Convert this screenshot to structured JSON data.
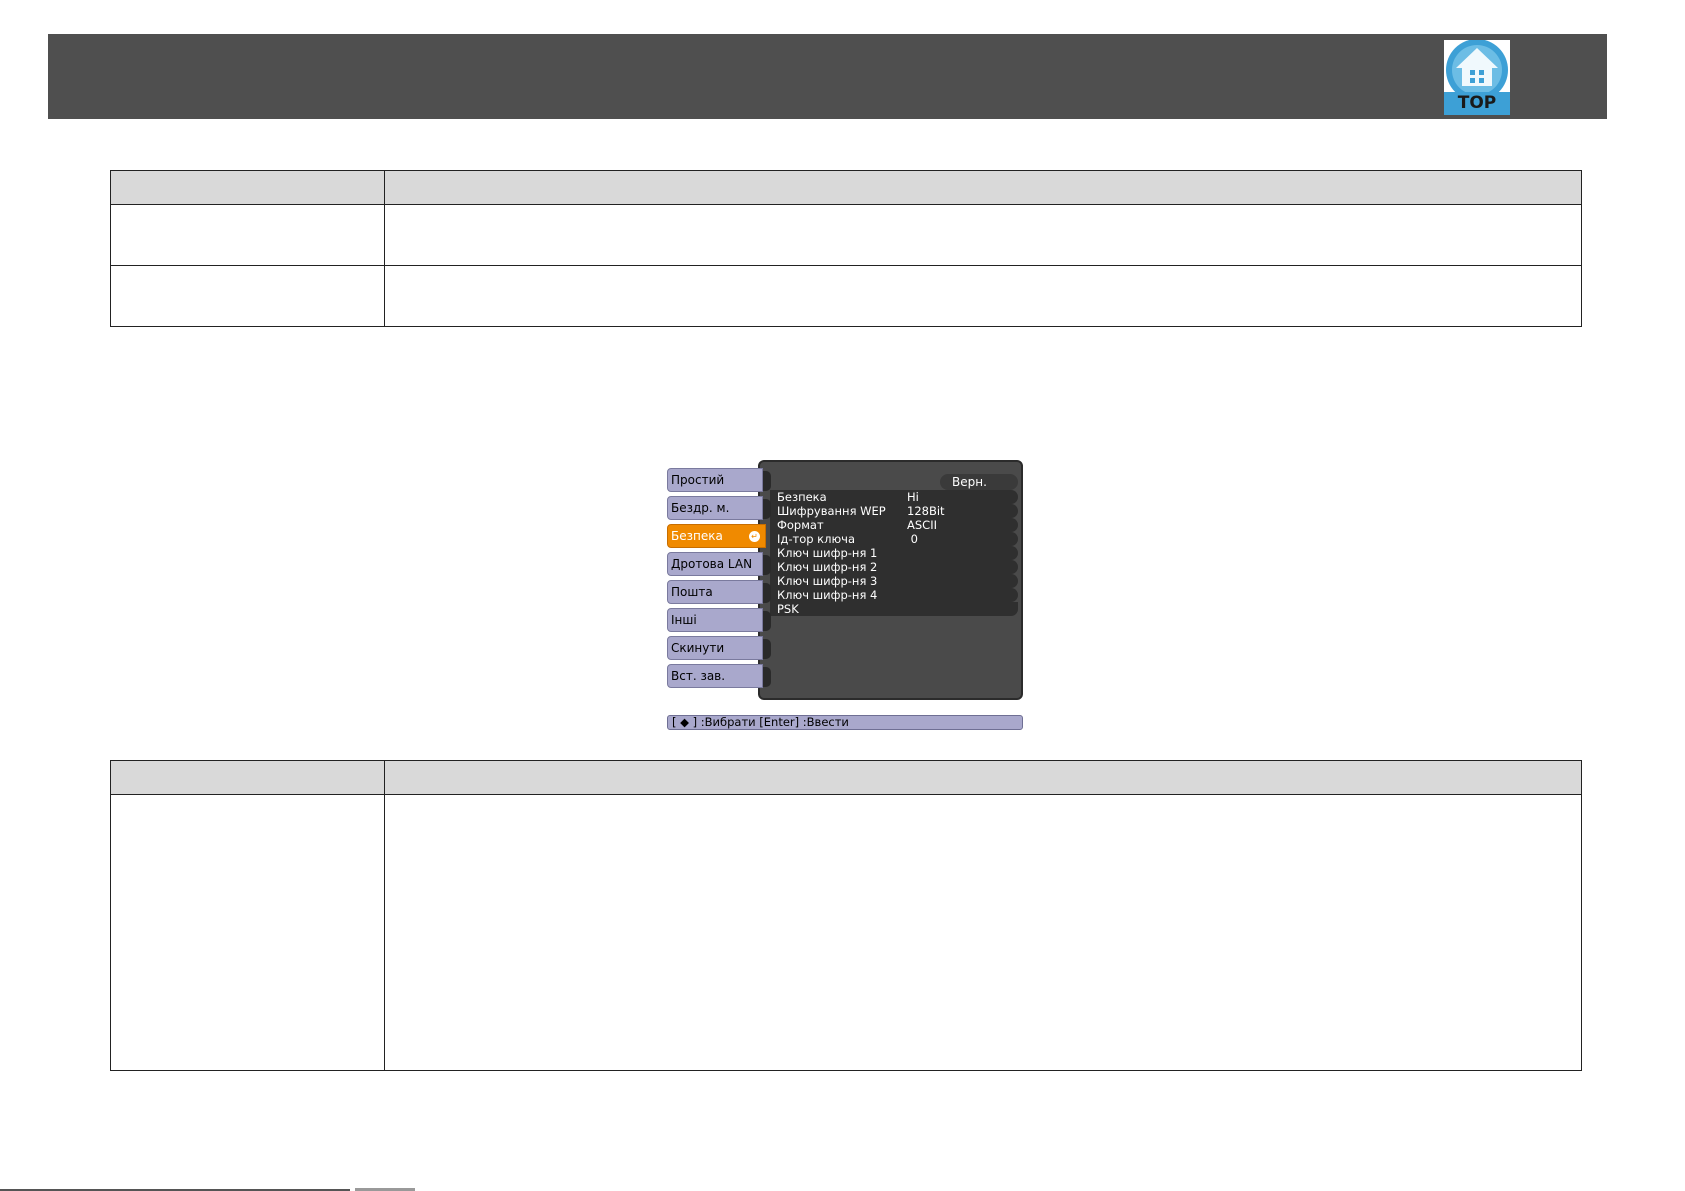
{
  "header": {
    "top_button_label": "TOP"
  },
  "table1": {
    "header": [
      "",
      ""
    ],
    "rows": [
      [
        "",
        ""
      ],
      [
        "",
        ""
      ]
    ]
  },
  "osd": {
    "tabs": [
      {
        "label": "Простий"
      },
      {
        "label": "Бездр. м."
      },
      {
        "label": "Безпека",
        "active": true
      },
      {
        "label": "Дротова LAN"
      },
      {
        "label": "Пошта"
      },
      {
        "label": "Інші"
      },
      {
        "label": "Скинути"
      },
      {
        "label": "Вст. зав."
      }
    ],
    "return_label": "Верн.",
    "settings": [
      {
        "label": "Безпека",
        "value": "Hi"
      },
      {
        "label": "Шифрування WEP",
        "value": "128Bit"
      },
      {
        "label": "Формат",
        "value": "ASCII"
      },
      {
        "label": "Ід-тор ключа",
        "value": " 0"
      },
      {
        "label": "Ключ шифр-ня 1",
        "value": ""
      },
      {
        "label": "Ключ шифр-ня 2",
        "value": ""
      },
      {
        "label": "Ключ шифр-ня 3",
        "value": ""
      },
      {
        "label": "Ключ шифр-ня 4",
        "value": ""
      },
      {
        "label": "PSK",
        "value": ""
      }
    ],
    "hint": "[ ◆ ] :Вибрати  [Enter] :Ввести"
  },
  "table2": {
    "header": [
      "",
      ""
    ],
    "rows": [
      [
        "",
        ""
      ]
    ]
  },
  "colors": {
    "header_band": "#4f4f4f",
    "tab_bg": "#a9a8cc",
    "tab_active": "#f08a00",
    "osd_panel": "#4a4a4a",
    "top_icon": "#3da0d6"
  }
}
